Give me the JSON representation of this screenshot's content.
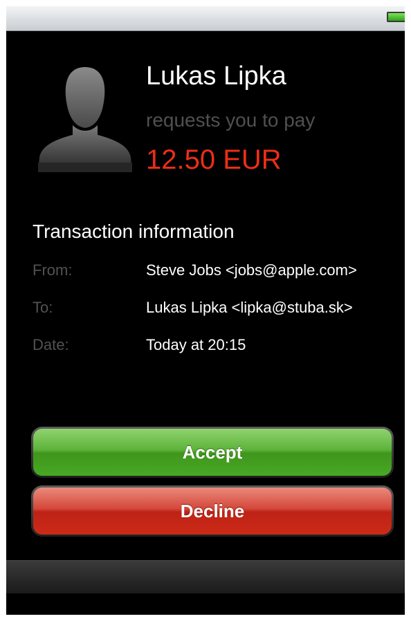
{
  "status_bar": {
    "battery_icon": "battery-full-icon",
    "battery_color": "#2ea318"
  },
  "request": {
    "avatar_icon": "person-silhouette-icon",
    "requester_name": "Lukas Lipka",
    "request_text": "requests you to pay",
    "amount": "12.50 EUR",
    "amount_color": "#ef2d17"
  },
  "transaction": {
    "title": "Transaction information",
    "rows": [
      {
        "label": "From:",
        "value": "Steve Jobs <jobs@apple.com>"
      },
      {
        "label": "To:",
        "value": "Lukas Lipka <lipka@stuba.sk>"
      },
      {
        "label": "Date:",
        "value": "Today at 20:15"
      }
    ]
  },
  "actions": {
    "accept_label": "Accept",
    "accept_color": "#48a825",
    "decline_label": "Decline",
    "decline_color": "#cc2a17"
  }
}
